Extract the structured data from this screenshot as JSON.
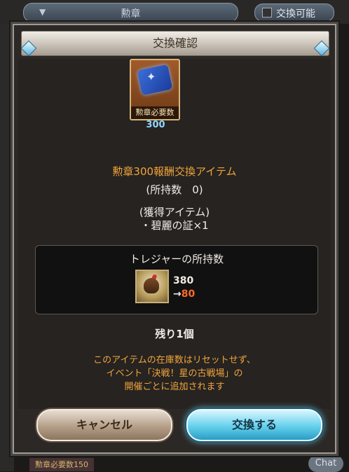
{
  "background": {
    "filter_label": "勲章",
    "toggle_label": "交換可能",
    "chat_label": "Chat",
    "bottom_chip": "勲章必要数150"
  },
  "dialog": {
    "title": "交換確認",
    "item": {
      "badge_label": "勲章必要数",
      "badge_value": "300",
      "name": "勲章300報酬交換アイテム",
      "held": "(所持数　0)",
      "acquired_header": "(獲得アイテム)",
      "acquired_item": "・碧麗の証×1"
    },
    "treasure": {
      "title": "トレジャーの所持数",
      "current": "380",
      "arrow": "→",
      "after": "80"
    },
    "remaining": "残り1個",
    "notes": [
      "このアイテムの在庫数はリセットせず、",
      "イベント「決戦！星の古戦場」の",
      "開催ごとに追加されます"
    ],
    "buttons": {
      "cancel": "キャンセル",
      "confirm": "交換する"
    }
  },
  "colors": {
    "accent_orange": "#f2a53a",
    "after_value": "#ff6a2a",
    "confirm_blue": "#64d0ec"
  }
}
